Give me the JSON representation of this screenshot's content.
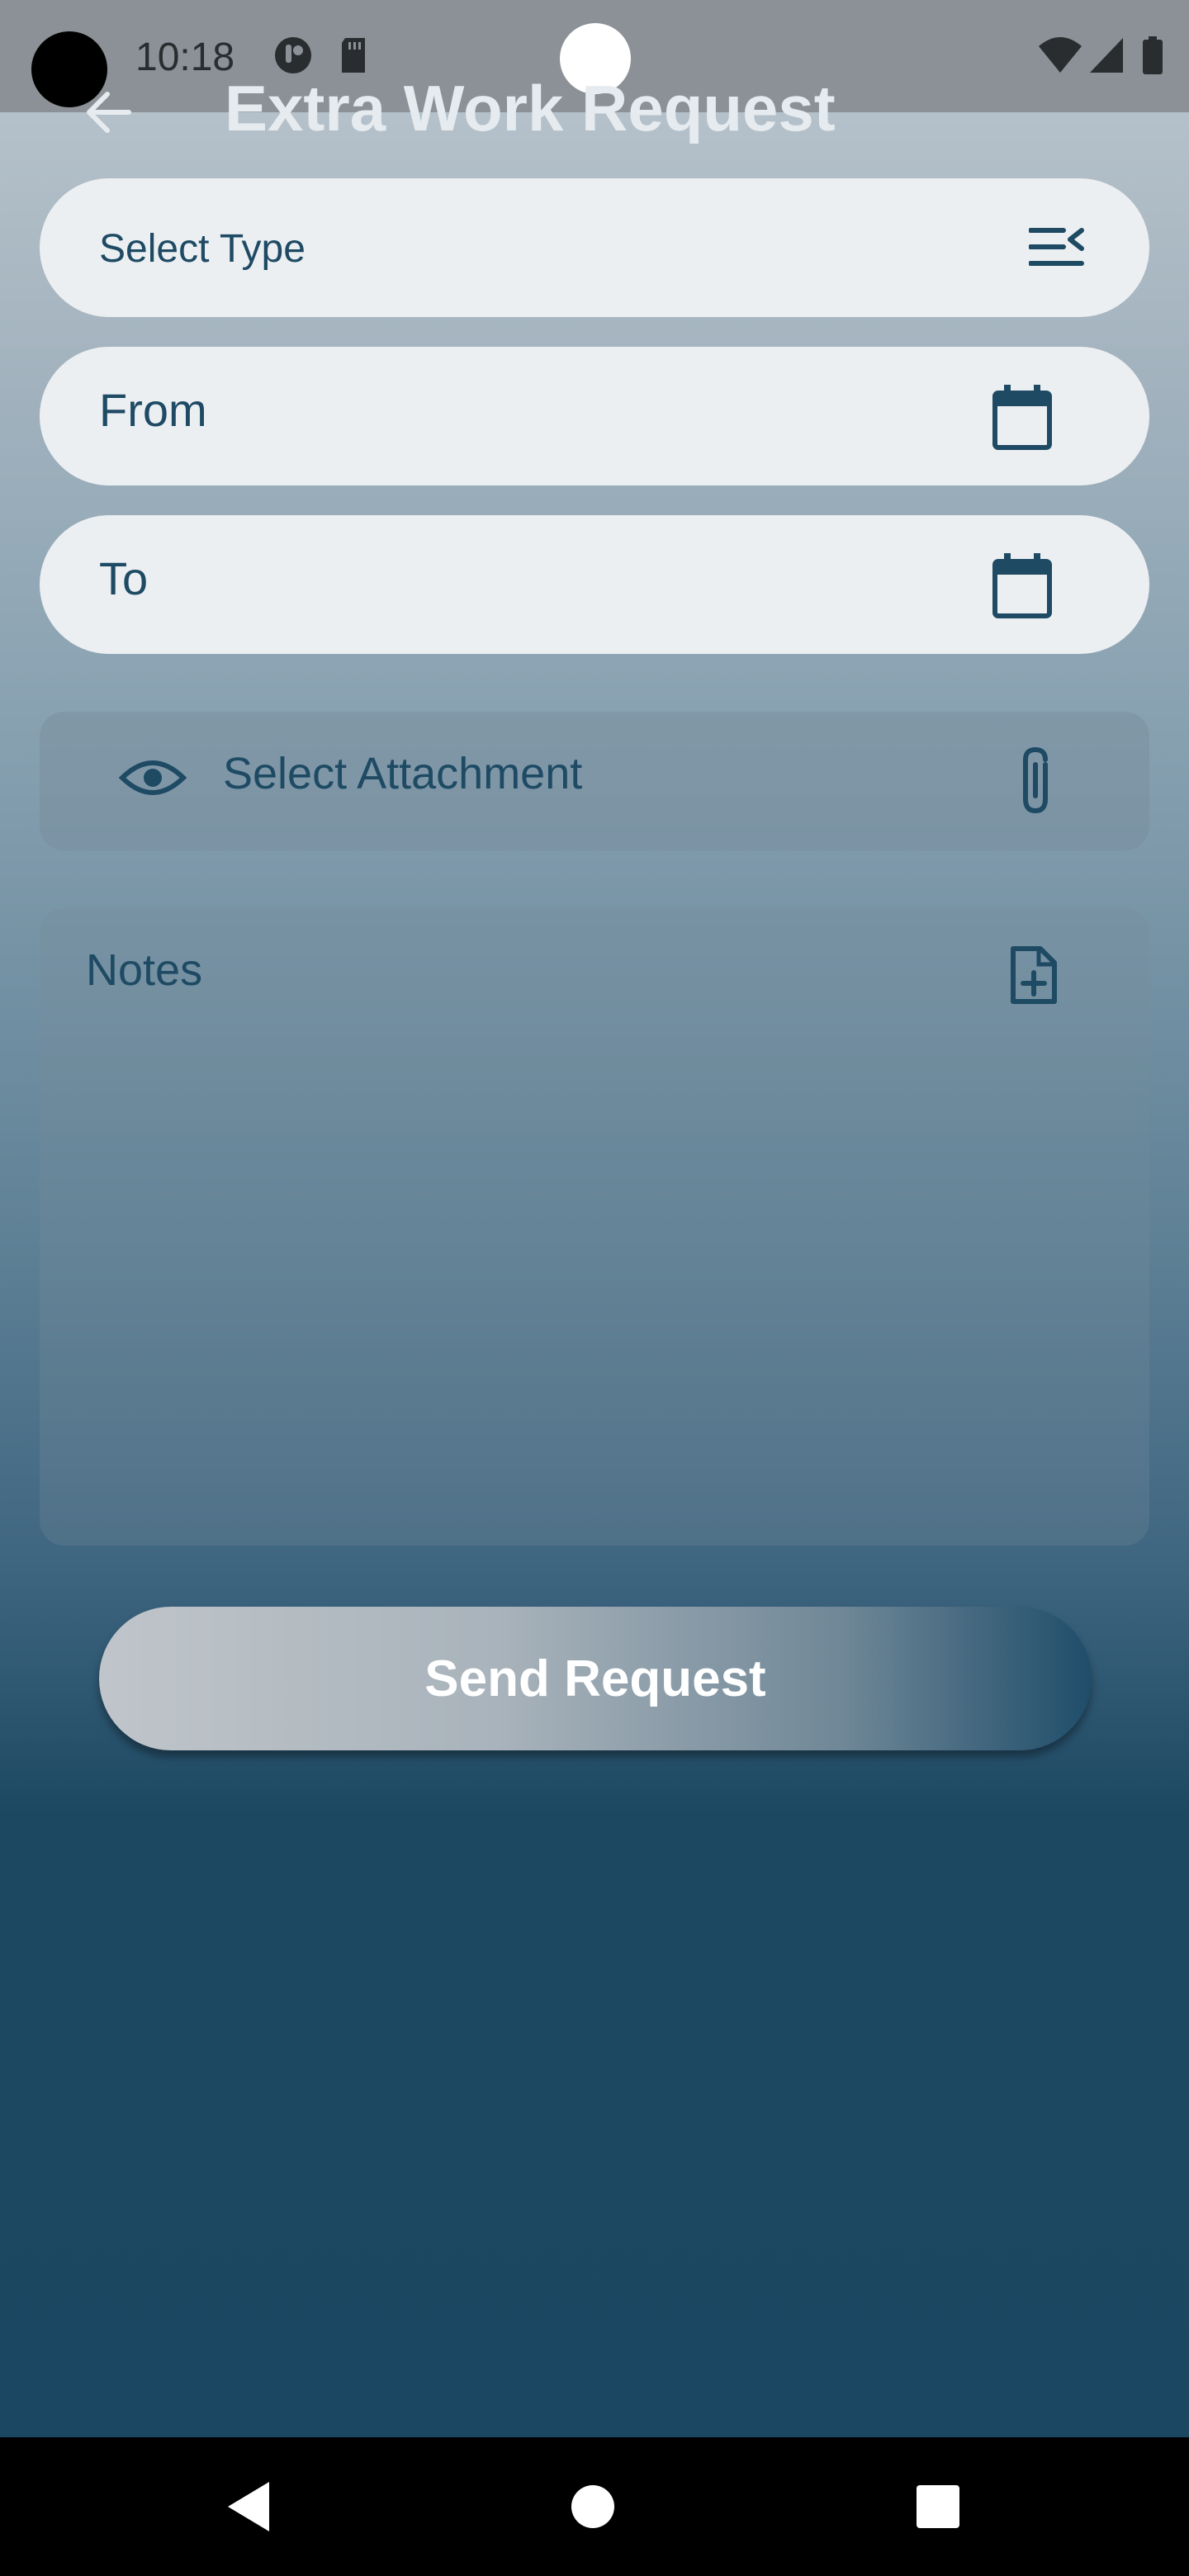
{
  "status_bar": {
    "time": "10:18"
  },
  "app_bar": {
    "title": "Extra Work Request"
  },
  "form": {
    "type_field": {
      "label": "Select Type"
    },
    "from_field": {
      "label": "From"
    },
    "to_field": {
      "label": "To"
    },
    "attachment": {
      "label": "Select Attachment"
    },
    "notes": {
      "placeholder": "Notes"
    }
  },
  "actions": {
    "send_label": "Send Request"
  },
  "colors": {
    "primary": "#1e4a64",
    "field_background": "#eceff2",
    "title_text": "#e6ebef"
  },
  "icons": {
    "back": "arrow-left-icon",
    "type": "list-collapse-icon",
    "calendar": "calendar-icon",
    "eye": "eye-icon",
    "attach": "paperclip-icon",
    "note": "file-plus-icon"
  }
}
